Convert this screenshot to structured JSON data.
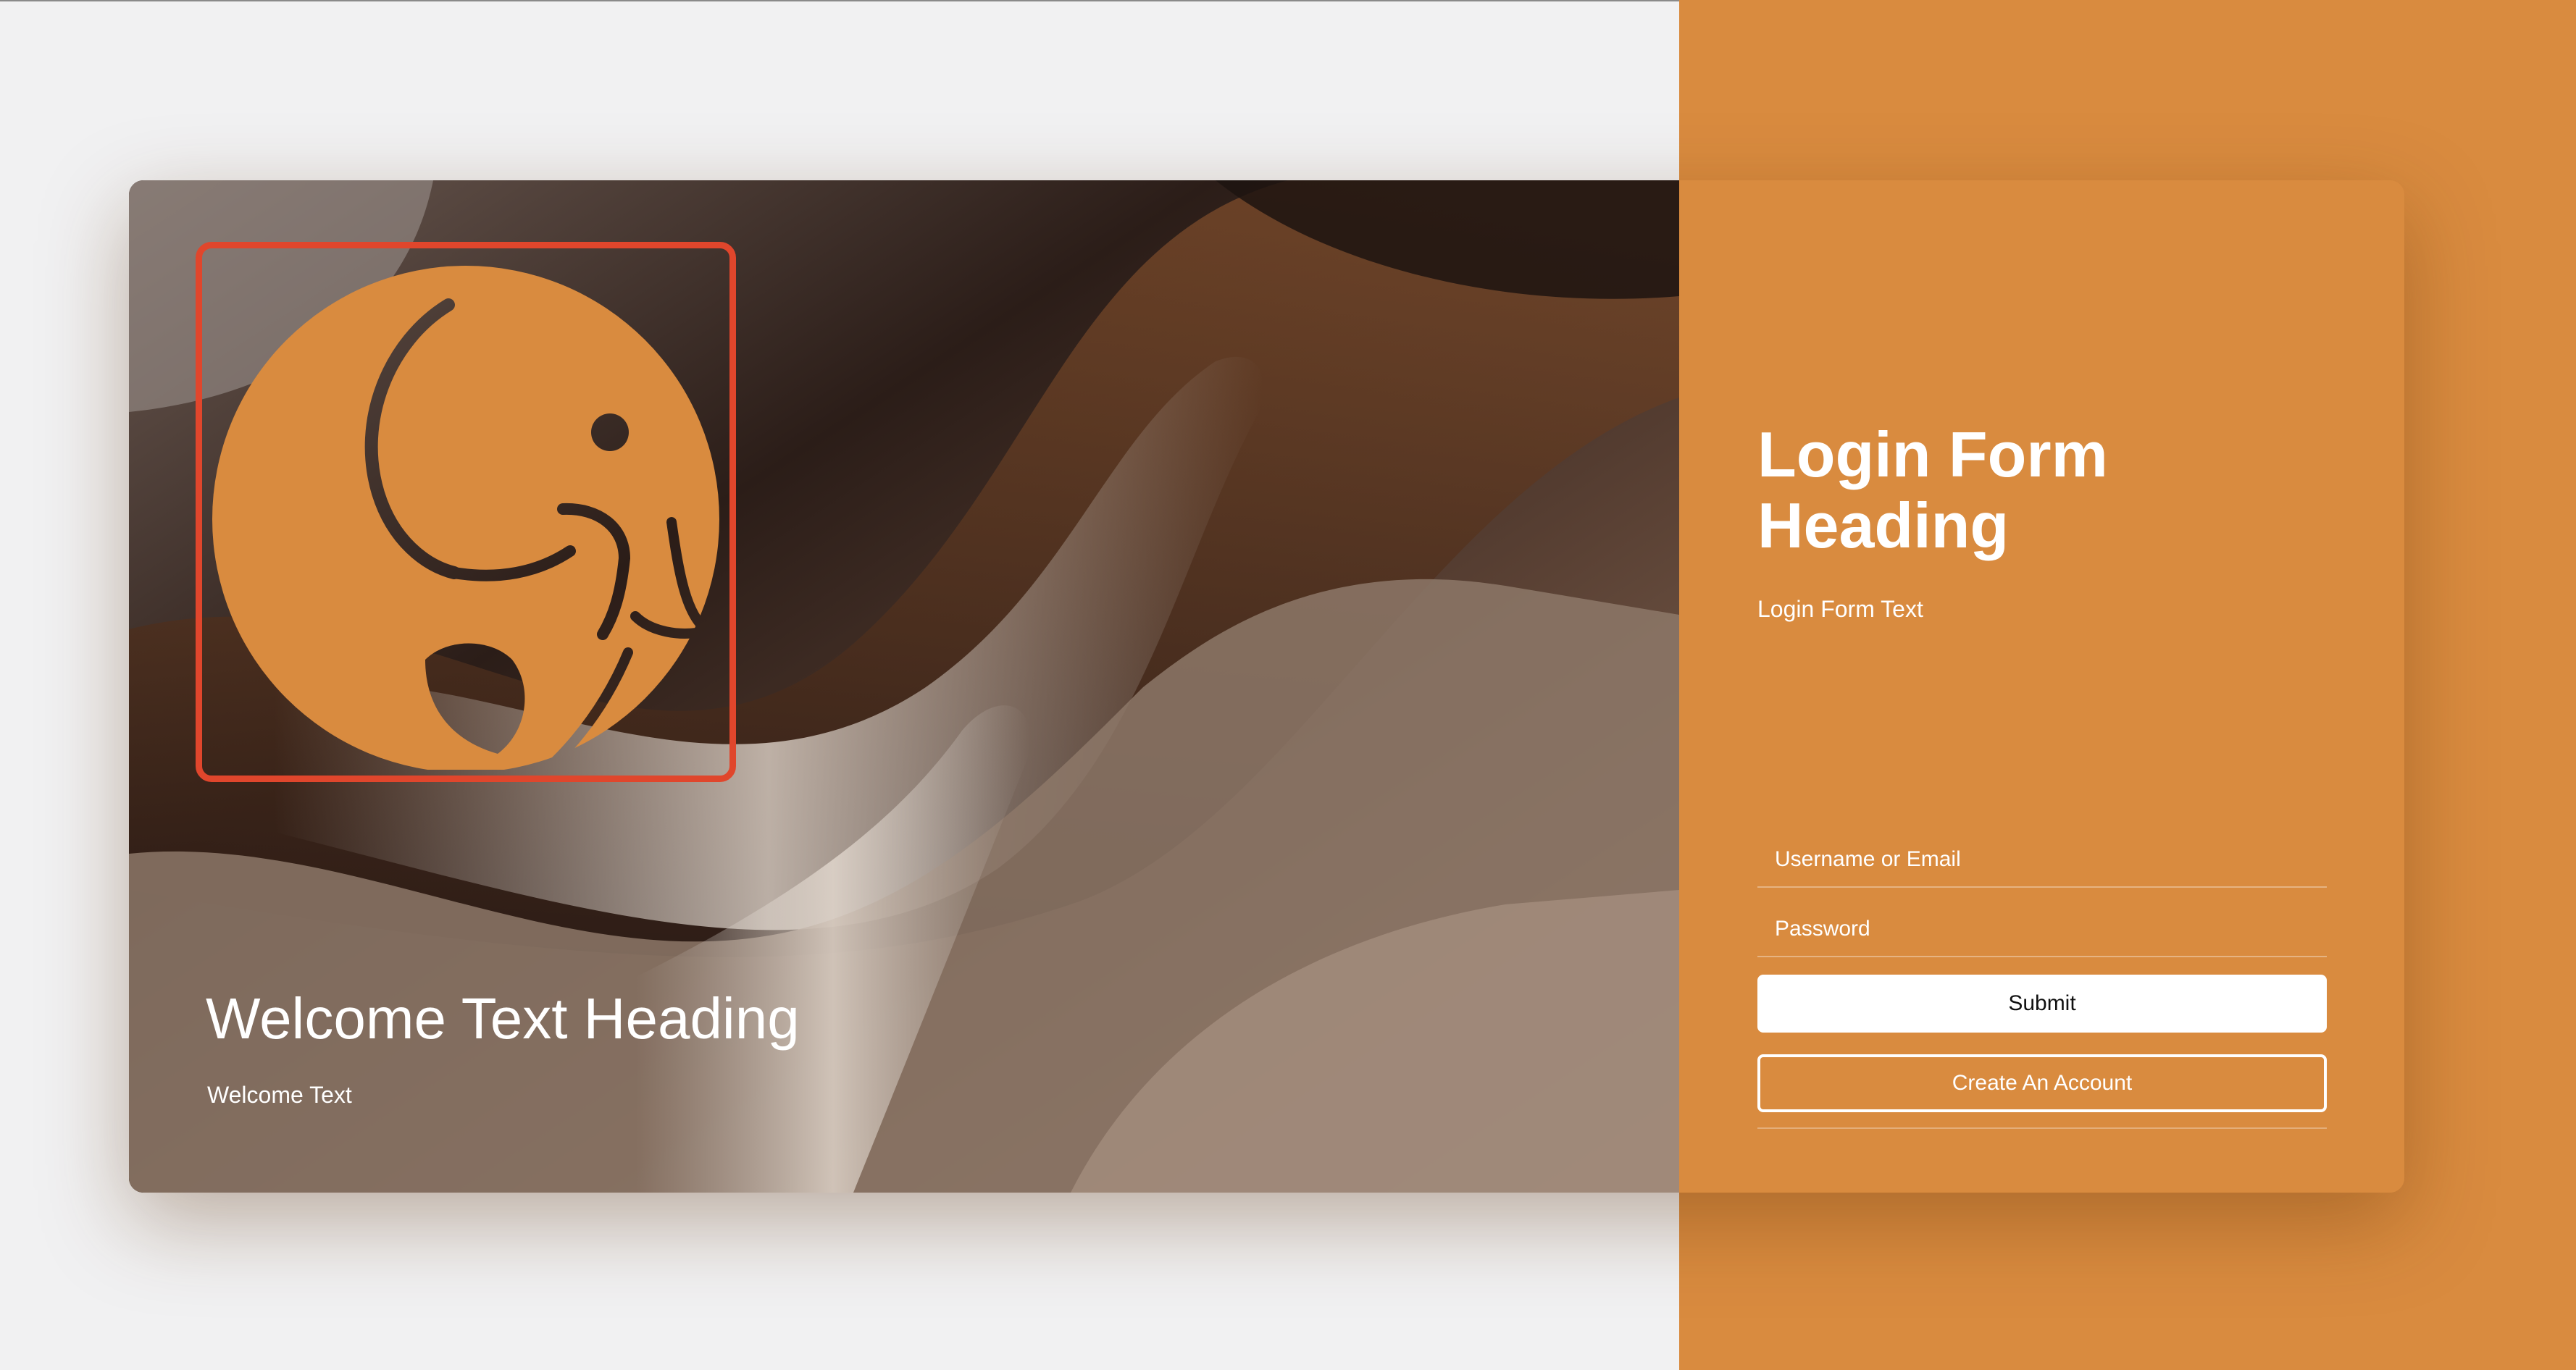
{
  "colors": {
    "accent": "#d98b3f",
    "logo_border": "#e0462c",
    "background": "#f1f1f2",
    "text_light": "#ffffff"
  },
  "hero": {
    "logo_icon": "elephant-icon",
    "welcome_heading": "Welcome Text Heading",
    "welcome_text": "Welcome Text"
  },
  "login": {
    "heading": "Login Form Heading",
    "text": "Login Form Text",
    "username_placeholder": "Username or Email",
    "password_placeholder": "Password",
    "submit_label": "Submit",
    "create_account_label": "Create An Account"
  }
}
